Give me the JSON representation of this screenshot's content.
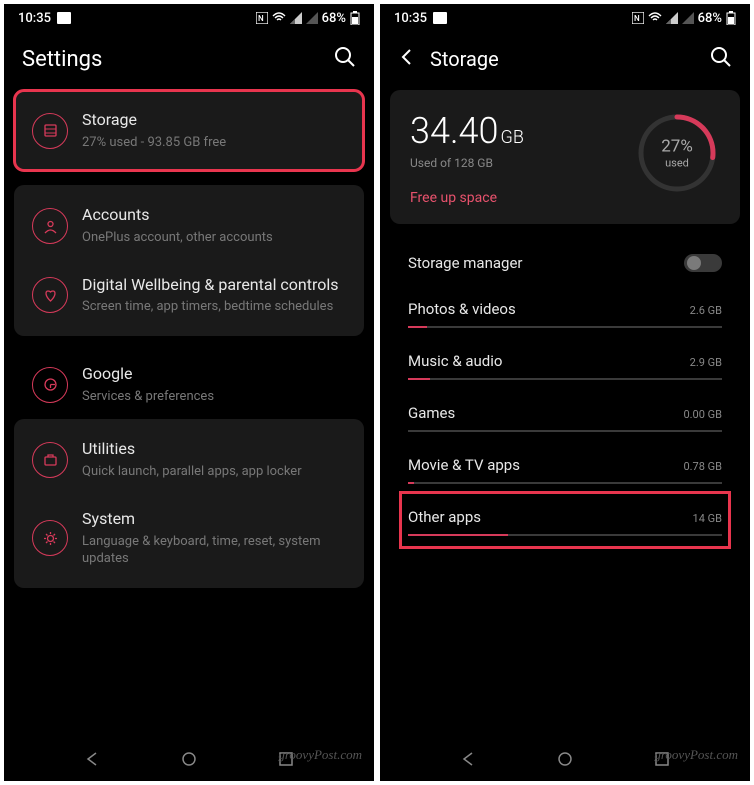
{
  "status": {
    "time": "10:35",
    "battery": "68%"
  },
  "left": {
    "title": "Settings",
    "groups": [
      {
        "highlight": true,
        "rows": [
          {
            "icon": "storage",
            "title": "Storage",
            "sub": "27% used - 93.85 GB free"
          }
        ]
      },
      {
        "rows": [
          {
            "icon": "account",
            "title": "Accounts",
            "sub": "OnePlus account, other accounts"
          },
          {
            "icon": "heart",
            "title": "Digital Wellbeing & parental controls",
            "sub": "Screen time, app timers, bedtime schedules"
          }
        ]
      },
      {
        "plain": true,
        "rows": [
          {
            "icon": "google",
            "title": "Google",
            "sub": "Services & preferences"
          }
        ]
      },
      {
        "rows": [
          {
            "icon": "utilities",
            "title": "Utilities",
            "sub": "Quick launch, parallel apps, app locker"
          },
          {
            "icon": "system",
            "title": "System",
            "sub": "Language & keyboard, time, reset, system updates"
          }
        ]
      }
    ]
  },
  "right": {
    "title": "Storage",
    "usedNum": "34.40",
    "usedUnit": "GB",
    "usedOf": "Used of 128 GB",
    "pct": "27%",
    "pctNum": 27,
    "pctLabel": "used",
    "freeUp": "Free up space",
    "storageManager": "Storage manager",
    "categories": [
      {
        "name": "Photos & videos",
        "size": "2.6 GB",
        "pct": 6
      },
      {
        "name": "Music & audio",
        "size": "2.9 GB",
        "pct": 7
      },
      {
        "name": "Games",
        "size": "0.00 GB",
        "pct": 0
      },
      {
        "name": "Movie & TV apps",
        "size": "0.78 GB",
        "pct": 2
      },
      {
        "name": "Other apps",
        "size": "14 GB",
        "pct": 32,
        "highlight": true
      }
    ]
  },
  "watermark": "groovyPost.com"
}
